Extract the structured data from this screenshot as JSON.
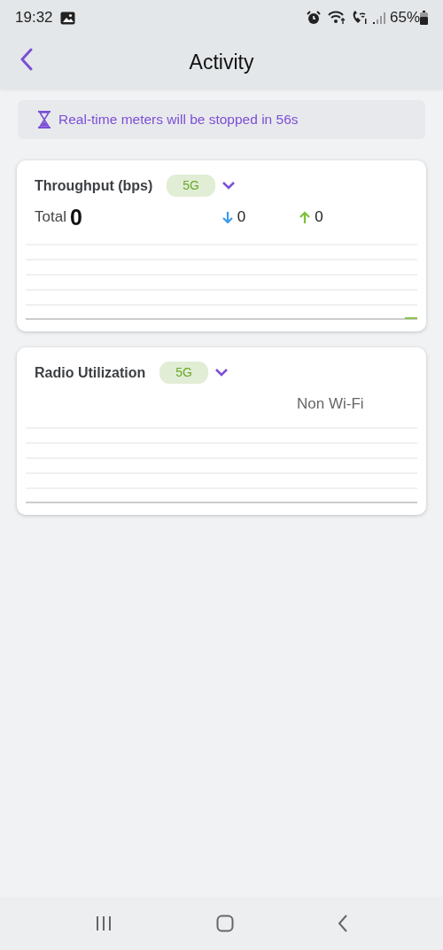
{
  "status_bar": {
    "time": "19:32",
    "battery": "65%"
  },
  "header": {
    "title": "Activity"
  },
  "notice": {
    "text": "Real-time meters will be stopped in 56s"
  },
  "cards": [
    {
      "kind": "throughput",
      "title": "Throughput (bps)",
      "band": "5G",
      "total_label": "Total",
      "total_value": "0",
      "down_value": "0",
      "up_value": "0"
    },
    {
      "kind": "radio",
      "title": "Radio Utilization",
      "band": "5G",
      "legend": "Non Wi-Fi"
    }
  ]
}
